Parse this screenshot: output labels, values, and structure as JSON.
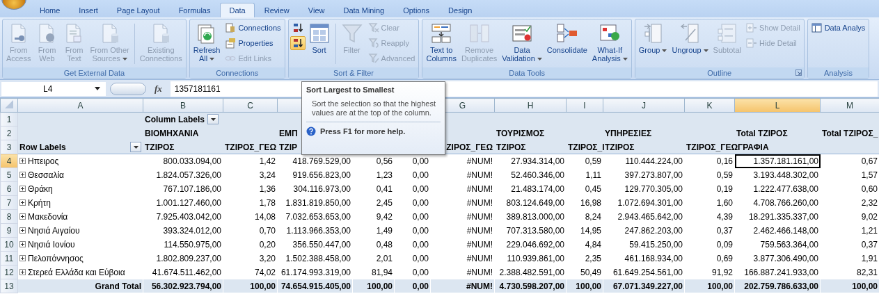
{
  "tabs": [
    {
      "label": "Home",
      "selected": false
    },
    {
      "label": "Insert",
      "selected": false
    },
    {
      "label": "Page Layout",
      "selected": false
    },
    {
      "label": "Formulas",
      "selected": false
    },
    {
      "label": "Data",
      "selected": true
    },
    {
      "label": "Review",
      "selected": false
    },
    {
      "label": "View",
      "selected": false
    },
    {
      "label": "Data Mining",
      "selected": false
    },
    {
      "label": "Options",
      "selected": false
    },
    {
      "label": "Design",
      "selected": false
    }
  ],
  "ribbon": [
    {
      "label": "Get External Data",
      "items": [
        {
          "kind": "large",
          "label": "From\nAccess",
          "disabled": true,
          "dropdown": false
        },
        {
          "kind": "large",
          "label": "From\nWeb",
          "disabled": true,
          "dropdown": false
        },
        {
          "kind": "large",
          "label": "From\nText",
          "disabled": true,
          "dropdown": false
        },
        {
          "kind": "large",
          "label": "From Other\nSources",
          "disabled": true,
          "dropdown": true
        },
        {
          "kind": "separator"
        },
        {
          "kind": "large",
          "label": "Existing\nConnections",
          "disabled": true,
          "dropdown": false
        }
      ]
    },
    {
      "label": "Connections",
      "items": [
        {
          "kind": "large",
          "label": "Refresh\nAll",
          "disabled": false,
          "dropdown": true
        },
        {
          "kind": "stack",
          "items": [
            {
              "label": "Connections",
              "disabled": false
            },
            {
              "label": "Properties",
              "disabled": false
            },
            {
              "label": "Edit Links",
              "disabled": true
            }
          ]
        }
      ]
    },
    {
      "label": "Sort & Filter",
      "items": [
        {
          "kind": "stack",
          "items": [
            {
              "disabled": false,
              "highlighted": false
            },
            {
              "disabled": false,
              "highlighted": true
            }
          ]
        },
        {
          "kind": "large",
          "label": "Sort",
          "disabled": false,
          "dropdown": false
        },
        {
          "kind": "separator"
        },
        {
          "kind": "large",
          "label": "Filter",
          "disabled": true,
          "dropdown": false
        },
        {
          "kind": "stack",
          "items": [
            {
              "label": "Clear",
              "disabled": true
            },
            {
              "label": "Reapply",
              "disabled": true
            },
            {
              "label": "Advanced",
              "disabled": true
            }
          ]
        }
      ]
    },
    {
      "label": "Data Tools",
      "items": [
        {
          "kind": "large",
          "label": "Text to\nColumns",
          "disabled": false,
          "dropdown": false
        },
        {
          "kind": "large",
          "label": "Remove\nDuplicates",
          "disabled": true,
          "dropdown": false
        },
        {
          "kind": "large",
          "label": "Data\nValidation",
          "disabled": false,
          "dropdown": true
        },
        {
          "kind": "large",
          "label": "Consolidate",
          "disabled": false,
          "dropdown": false
        },
        {
          "kind": "large",
          "label": "What-If\nAnalysis",
          "disabled": false,
          "dropdown": true
        }
      ]
    },
    {
      "label": "Outline",
      "launcher": true,
      "items": [
        {
          "kind": "large",
          "label": "Group",
          "disabled": false,
          "dropdown": true
        },
        {
          "kind": "large",
          "label": "Ungroup",
          "disabled": false,
          "dropdown": true
        },
        {
          "kind": "large",
          "label": "Subtotal",
          "disabled": true,
          "dropdown": false
        },
        {
          "kind": "stack",
          "items": [
            {
              "label": "Show Detail",
              "disabled": true
            },
            {
              "label": "Hide Detail",
              "disabled": true
            }
          ]
        }
      ]
    },
    {
      "label": "Analysis",
      "items": [
        {
          "kind": "stack",
          "items": [
            {
              "label": "Data Analys",
              "disabled": false
            }
          ]
        }
      ]
    }
  ],
  "name_box": "L4",
  "function_button": "fx",
  "formula": "1357181161",
  "columns": [
    {
      "label": "A",
      "selected": false
    },
    {
      "label": "B",
      "selected": false
    },
    {
      "label": "C",
      "selected": false
    },
    null,
    null,
    null,
    {
      "label": "G",
      "selected": false
    },
    {
      "label": "H",
      "selected": false
    },
    {
      "label": "I",
      "selected": false
    },
    {
      "label": "J",
      "selected": false
    },
    {
      "label": "K",
      "selected": false
    },
    {
      "label": "L",
      "selected": true
    },
    {
      "label": "M",
      "selected": false
    }
  ],
  "header_rows": [
    {
      "num": "1",
      "cells": [
        null,
        {
          "text": "Column Labels",
          "filter_button": true
        },
        null,
        null,
        null,
        null,
        null,
        null,
        null,
        null,
        null,
        null,
        null
      ]
    },
    {
      "num": "2",
      "cells": [
        null,
        {
          "text": "ΒΙΟΜΗΧΑΝΙΑ"
        },
        null,
        {
          "text": "ΕΜΠ"
        },
        null,
        null,
        null,
        {
          "text": "ΤΟΥΡΙΣΜΟΣ"
        },
        null,
        {
          "text": "ΥΠΗΡΕΣΙΕΣ"
        },
        null,
        {
          "text": "Total ΤΖΙΡΟΣ"
        },
        {
          "text": "Total ΤΖΙΡΟΣ_"
        }
      ]
    },
    {
      "num": "3",
      "cells": [
        {
          "text": "Row Labels",
          "filter_button": true
        },
        {
          "text": "ΤΖΙΡΟΣ"
        },
        {
          "text": "ΤΖΙΡΟΣ_ΓΕΩ"
        },
        {
          "text": "ΤΖΙΡ"
        },
        null,
        null,
        {
          "text": "ΖΙΡΟΣ_ΓΕΩ"
        },
        {
          "text": "ΤΖΙΡΟΣ"
        },
        {
          "text": "ΤΖΙΡΟΣ_Ι"
        },
        {
          "text": "ΤΖΙΡΟΣ"
        },
        {
          "text": "ΤΖΙΡΟΣ_ΓΕΩΓΡΑΦΙΑ"
        },
        null,
        null
      ]
    }
  ],
  "rows": [
    {
      "num": "4",
      "label": "Ηπειρος",
      "selected": true,
      "expanded": false,
      "values": [
        "800.033.094,00",
        "1,42",
        "418.769.529,00",
        "0,56",
        "0,00",
        "#NUM!",
        "27.934.314,00",
        "0,59",
        "110.444.224,00",
        "0,16",
        "1.357.181.161,00",
        "0,67"
      ]
    },
    {
      "num": "5",
      "label": "Θεσσαλία",
      "selected": false,
      "expanded": false,
      "values": [
        "1.824.057.326,00",
        "3,24",
        "919.656.823,00",
        "1,23",
        "0,00",
        "#NUM!",
        "52.460.346,00",
        "1,11",
        "397.273.807,00",
        "0,59",
        "3.193.448.302,00",
        "1,57"
      ]
    },
    {
      "num": "6",
      "label": "Θράκη",
      "selected": false,
      "expanded": false,
      "values": [
        "767.107.186,00",
        "1,36",
        "304.116.973,00",
        "0,41",
        "0,00",
        "#NUM!",
        "21.483.174,00",
        "0,45",
        "129.770.305,00",
        "0,19",
        "1.222.477.638,00",
        "0,60"
      ]
    },
    {
      "num": "7",
      "label": "Κρήτη",
      "selected": false,
      "expanded": false,
      "values": [
        "1.001.127.460,00",
        "1,78",
        "1.831.819.850,00",
        "2,45",
        "0,00",
        "#NUM!",
        "803.124.649,00",
        "16,98",
        "1.072.694.301,00",
        "1,60",
        "4.708.766.260,00",
        "2,32"
      ]
    },
    {
      "num": "8",
      "label": "Μακεδονία",
      "selected": false,
      "expanded": false,
      "values": [
        "7.925.403.042,00",
        "14,08",
        "7.032.653.653,00",
        "9,42",
        "0,00",
        "#NUM!",
        "389.813.000,00",
        "8,24",
        "2.943.465.642,00",
        "4,39",
        "18.291.335.337,00",
        "9,02"
      ]
    },
    {
      "num": "9",
      "label": "Νησιά Αιγαίου",
      "selected": false,
      "expanded": false,
      "values": [
        "393.324.012,00",
        "0,70",
        "1.113.966.353,00",
        "1,49",
        "0,00",
        "#NUM!",
        "707.313.580,00",
        "14,95",
        "247.862.203,00",
        "0,37",
        "2.462.466.148,00",
        "1,21"
      ]
    },
    {
      "num": "10",
      "label": "Νησιά Ιονίου",
      "selected": false,
      "expanded": false,
      "values": [
        "114.550.975,00",
        "0,20",
        "356.550.447,00",
        "0,48",
        "0,00",
        "#NUM!",
        "229.046.692,00",
        "4,84",
        "59.415.250,00",
        "0,09",
        "759.563.364,00",
        "0,37"
      ]
    },
    {
      "num": "11",
      "label": "Πελοπόννησος",
      "selected": false,
      "expanded": false,
      "values": [
        "1.802.809.237,00",
        "3,20",
        "1.502.388.458,00",
        "2,01",
        "0,00",
        "#NUM!",
        "110.939.861,00",
        "2,35",
        "461.168.934,00",
        "0,69",
        "3.877.306.490,00",
        "1,91"
      ]
    },
    {
      "num": "12",
      "label": "Στερεά Ελλάδα και Εύβοια",
      "selected": false,
      "expanded": false,
      "values": [
        "41.674.511.462,00",
        "74,02",
        "61.174.993.319,00",
        "81,94",
        "0,00",
        "#NUM!",
        "2.388.482.591,00",
        "50,49",
        "61.649.254.561,00",
        "91,92",
        "166.887.241.933,00",
        "82,31"
      ]
    }
  ],
  "grand_total": {
    "num": "13",
    "label": "Grand Total",
    "values": [
      "56.302.923.794,00",
      "100,00",
      "74.654.915.405,00",
      "100,00",
      "0,00",
      "#NUM!",
      "4.730.598.207,00",
      "100,00",
      "67.071.349.227,00",
      "100,00",
      "202.759.786.633,00",
      "100,00"
    ]
  },
  "tooltip": {
    "title": "Sort Largest to Smallest",
    "body": "Sort the selection so that the highest values are at the top of the column.",
    "help": "Press F1 for more help."
  }
}
